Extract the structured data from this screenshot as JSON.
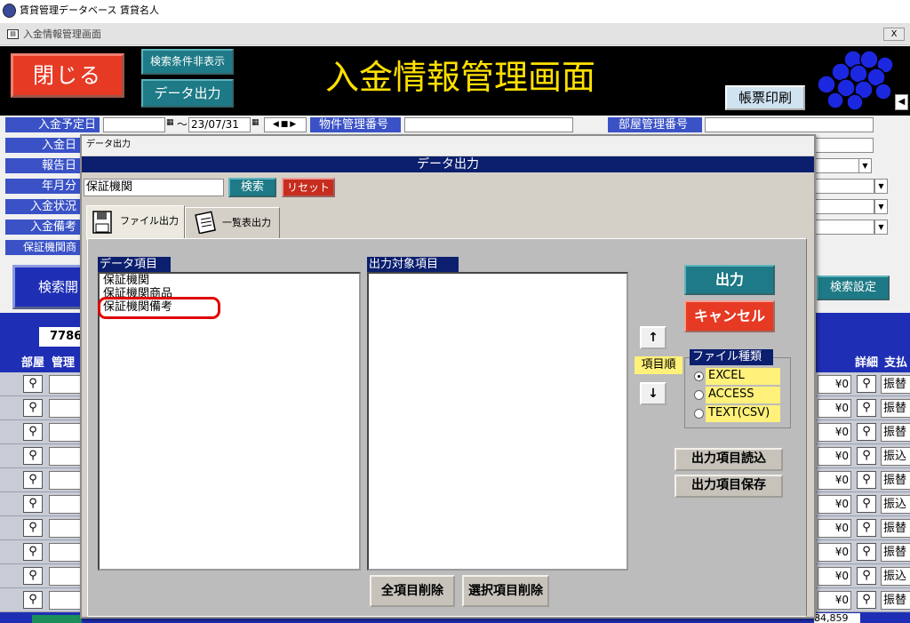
{
  "app": {
    "title": "賃貸管理データベース 賃貸名人"
  },
  "window": {
    "title": "入金情報管理画面",
    "close_label": "X"
  },
  "header": {
    "close_label": "閉じる",
    "toggle_filter_label": "検索条件非表示",
    "data_output_label": "データ出力",
    "page_title": "入金情報管理画面",
    "print_label": "帳票印刷"
  },
  "filters": {
    "scheduled_date_label": "入金予定日",
    "date_range_sep": "〜",
    "scheduled_date_to": "23/07/31",
    "property_no_label": "物件管理番号",
    "room_no_label": "部屋管理番号",
    "payment_date_label": "入金日",
    "report_date_label": "報告日",
    "year_month_label": "年月分",
    "status_label": "入金状況",
    "remarks_label": "入金備考",
    "guarantor_label": "保証機関商"
  },
  "search": {
    "button_label": "検索開",
    "settings_label": "検索設定"
  },
  "grid": {
    "record_count": "7786",
    "columns": {
      "room": "部屋",
      "mgmt": "管理",
      "detail": "詳細",
      "payment": "支払"
    },
    "rows": [
      {
        "amount": "¥0",
        "method": "振替"
      },
      {
        "amount": "¥0",
        "method": "振替"
      },
      {
        "amount": "¥0",
        "method": "振替"
      },
      {
        "amount": "¥0",
        "method": "振込"
      },
      {
        "amount": "¥0",
        "method": "振替"
      },
      {
        "amount": "¥0",
        "method": "振込"
      },
      {
        "amount": "¥0",
        "method": "振替"
      },
      {
        "amount": "¥0",
        "method": "振替"
      },
      {
        "amount": "¥0",
        "method": "振込"
      },
      {
        "amount": "¥0",
        "method": "振替"
      }
    ],
    "total": "84,859"
  },
  "dialog": {
    "titlebar": "データ出力",
    "banner": "データ出力",
    "search_value": "保証機関",
    "search_label": "検索",
    "reset_label": "リセット",
    "tabs": [
      {
        "label": "ファイル出力",
        "icon": "floppy-disk-icon"
      },
      {
        "label": "一覧表出力",
        "icon": "notebook-icon"
      }
    ],
    "data_items_header": "データ項目",
    "data_items": [
      "保証機関",
      "保証機関商品",
      "保証機関備考"
    ],
    "output_items_header": "出力対象項目",
    "output_label": "出力",
    "cancel_label": "キャンセル",
    "up_arrow": "↑",
    "order_label": "項目順",
    "down_arrow": "↓",
    "file_type_label": "ファイル種類",
    "file_types": [
      "EXCEL",
      "ACCESS",
      "TEXT(CSV)"
    ],
    "selected_file_type": "EXCEL",
    "load_items_label": "出力項目読込",
    "save_items_label": "出力項目保存",
    "delete_all_label": "全項目削除",
    "delete_selected_label": "選択項目削除"
  },
  "colors": {
    "accent_red": "#e63a24",
    "teal": "#1d7a86",
    "navy": "#0b1f6e",
    "grid_blue": "#1f2fb5",
    "highlight_yellow": "#fff17a"
  }
}
